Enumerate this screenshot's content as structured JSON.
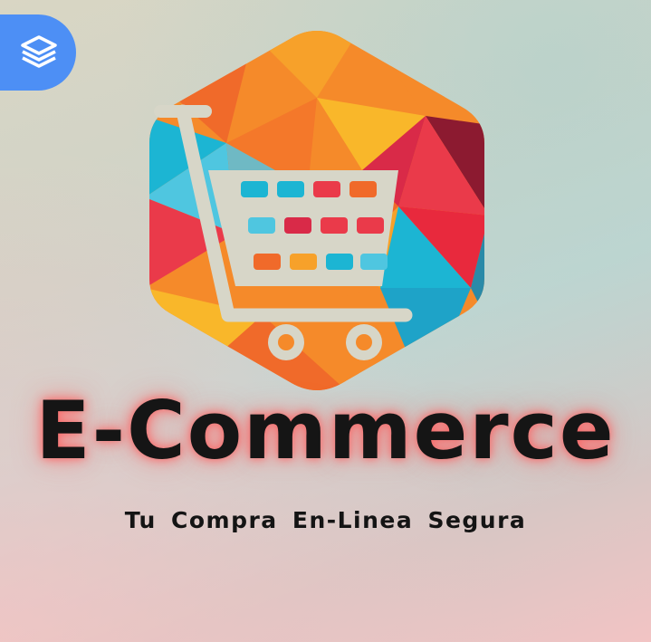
{
  "brand": {
    "name": "E-Commerce",
    "tagline": "Tu Compra En-Linea Segura"
  },
  "toolbar": {
    "layers_icon": "layers-icon"
  },
  "colors": {
    "accent_blue": "#4d8ff5",
    "cart": "#d7d6c8",
    "text": "#151515",
    "glow": "#ff5a5a",
    "hex_orange": "#f58a2a",
    "hex_red": "#ea3a4a",
    "hex_cyan": "#1cb5d3",
    "hex_yellow": "#f9b72a",
    "hex_maroon": "#8c1a30"
  }
}
